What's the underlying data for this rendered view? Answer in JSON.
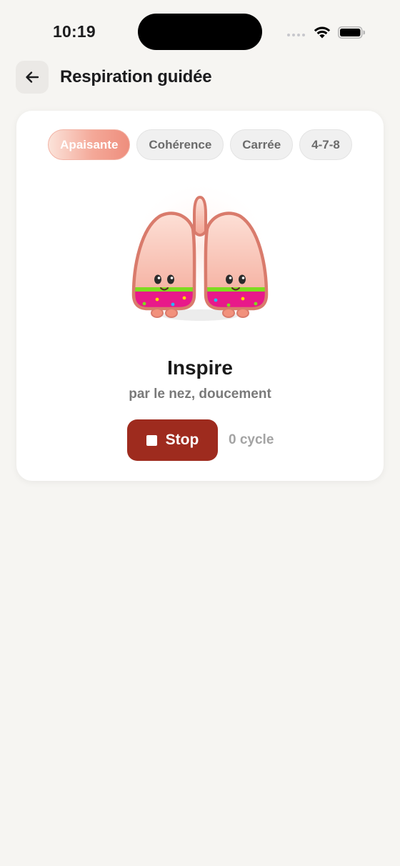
{
  "status_bar": {
    "time": "10:19"
  },
  "header": {
    "title": "Respiration guidée"
  },
  "tabs": [
    {
      "label": "Apaisante",
      "active": true
    },
    {
      "label": "Cohérence",
      "active": false
    },
    {
      "label": "Carrée",
      "active": false
    },
    {
      "label": "4-7-8",
      "active": false
    }
  ],
  "exercise": {
    "phase": "Inspire",
    "instruction": "par le nez, doucement",
    "stop_label": "Stop",
    "cycle_count": "0 cycle"
  },
  "colors": {
    "accent": "#9e2b1e",
    "tab_active_start": "#fbe3da",
    "tab_active_end": "#ee8e7d",
    "background": "#f6f5f2",
    "lung_fill": "#f7b9a8",
    "lung_outline": "#d97b6c",
    "lung_base": "#e8198a",
    "lung_stripe": "#7ddc1f"
  },
  "icons": {
    "back": "arrow-left-icon",
    "stop": "stop-square-icon",
    "illustration": "lungs-icon"
  }
}
